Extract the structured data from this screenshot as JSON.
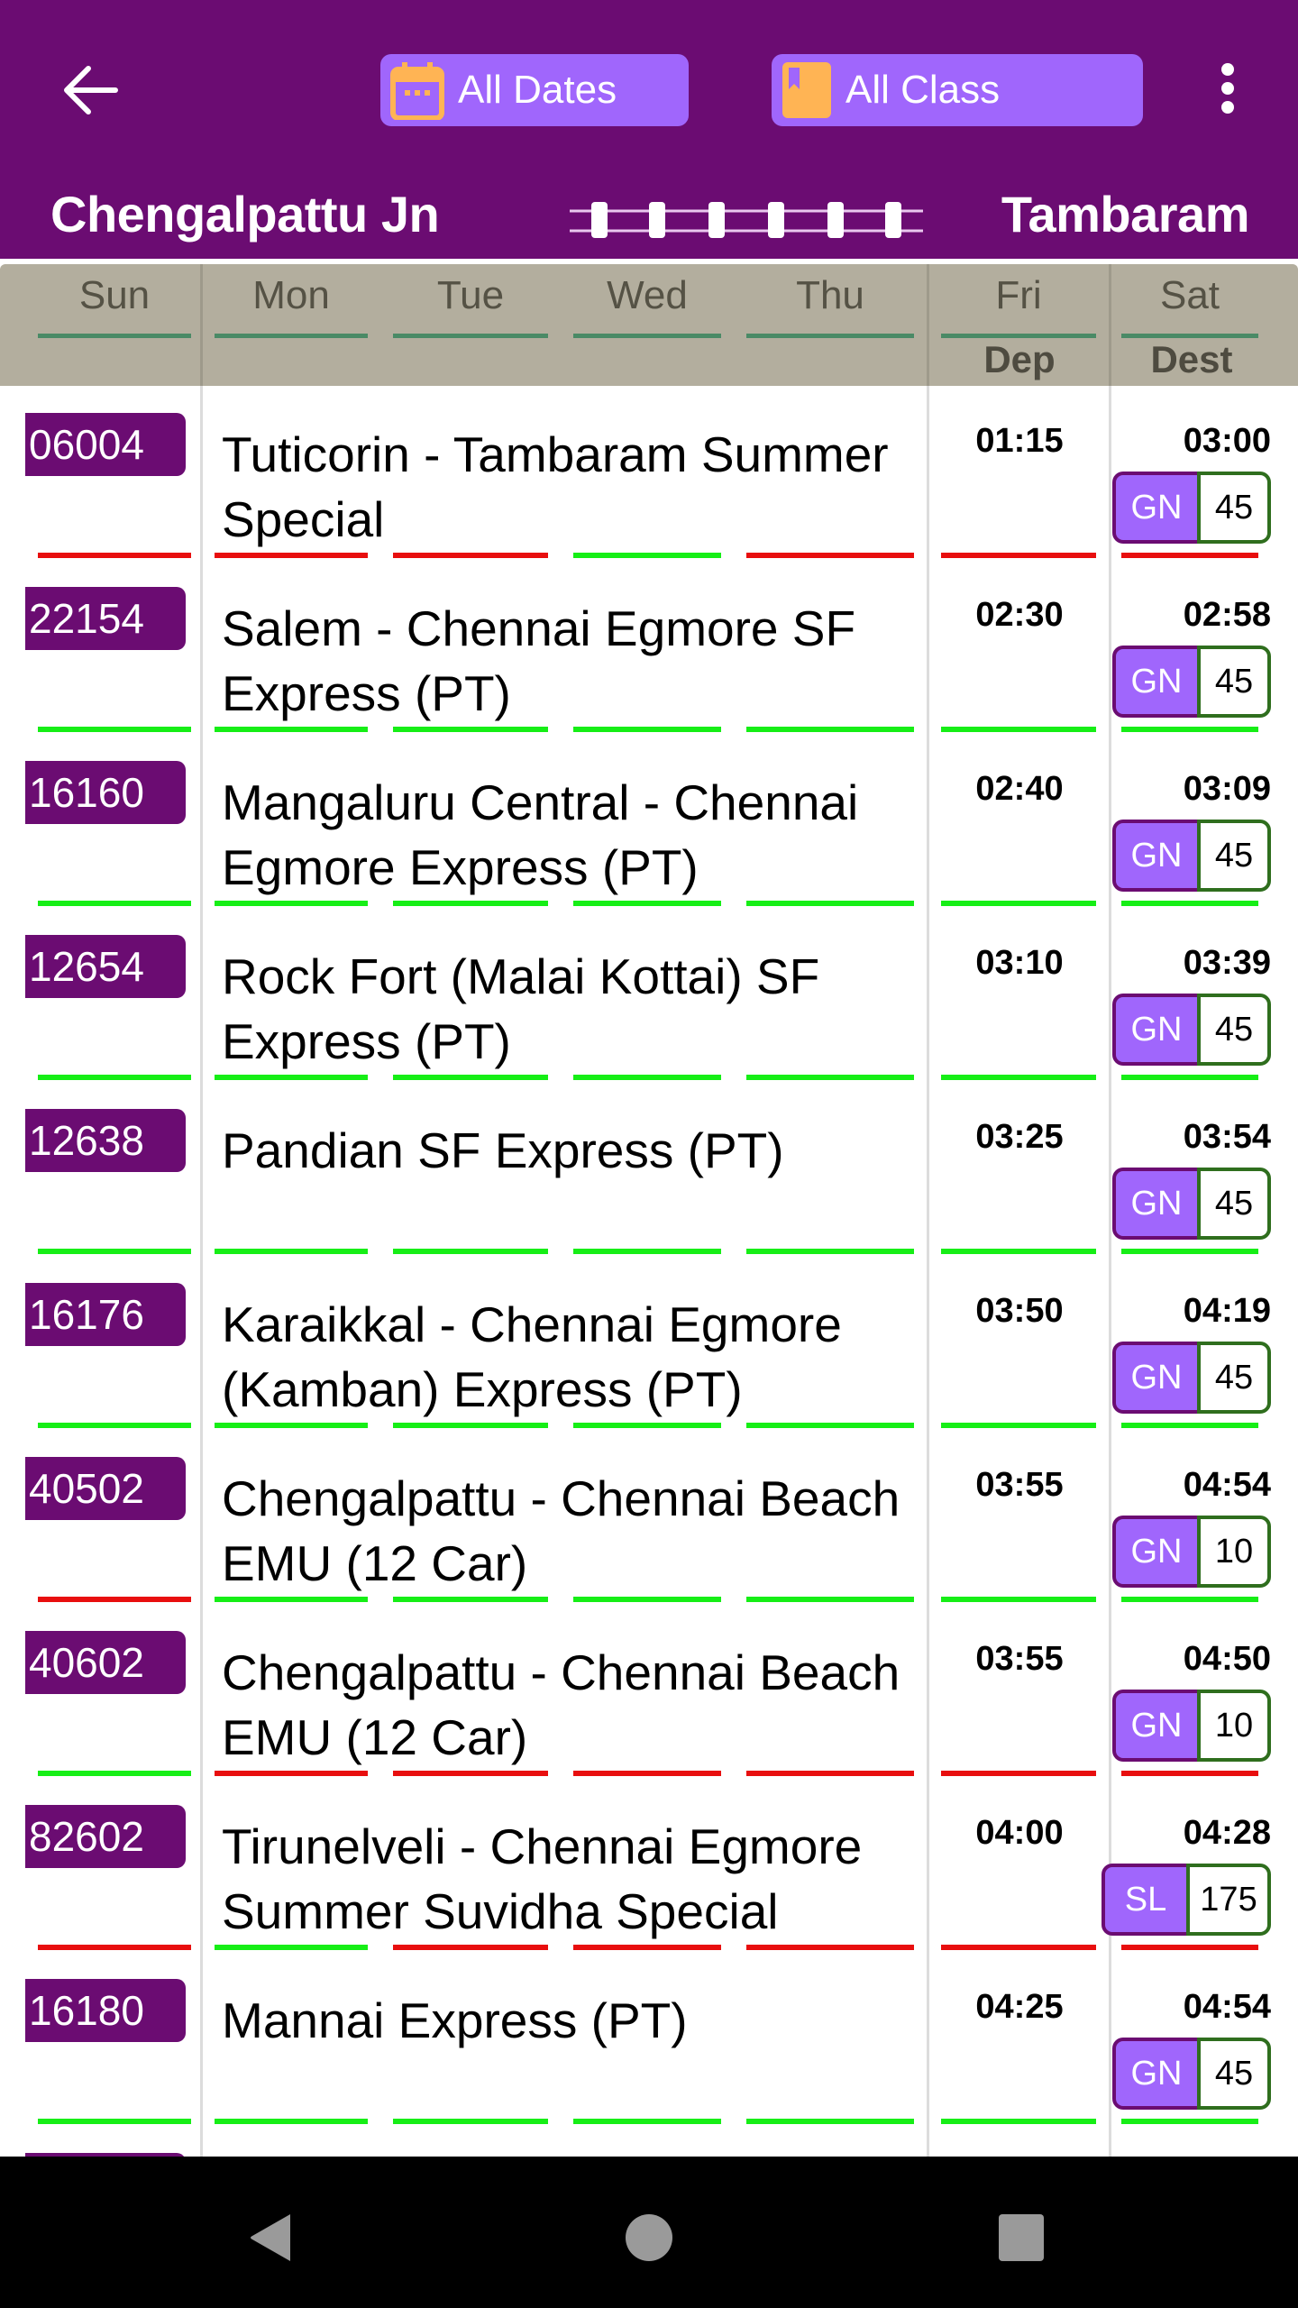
{
  "header": {
    "back_icon": "arrow-left-icon",
    "dates_button": {
      "label": "All Dates",
      "icon": "calendar-icon"
    },
    "class_button": {
      "label": "All Class",
      "icon": "bookmark-book-icon"
    },
    "menu_icon": "more-vertical-icon",
    "from_station": "Chengalpattu Jn",
    "to_station": "Tambaram",
    "route_icon": "rail-track-icon"
  },
  "colors": {
    "primary": "#6B0C72",
    "accent": "#A066FC",
    "icon_orange": "#FFB454",
    "header_gray": "#B3AE9E",
    "runs": "#16EE16",
    "not_runs": "#E80E0E"
  },
  "table_header": {
    "days": [
      "Sun",
      "Mon",
      "Tue",
      "Wed",
      "Thu",
      "Fri",
      "Sat"
    ],
    "dep_label": "Dep",
    "dest_label": "Dest"
  },
  "trains": [
    {
      "number": "06004",
      "name": "Tuticorin - Tambaram Summer Special",
      "dep": "01:15",
      "arr": "03:00",
      "class": "GN",
      "seats": "45",
      "days": [
        0,
        0,
        0,
        1,
        0,
        0,
        0
      ]
    },
    {
      "number": "22154",
      "name": "Salem - Chennai Egmore SF Express (PT)",
      "dep": "02:30",
      "arr": "02:58",
      "class": "GN",
      "seats": "45",
      "days": [
        1,
        1,
        1,
        1,
        1,
        1,
        1
      ]
    },
    {
      "number": "16160",
      "name": "Mangaluru Central - Chennai Egmore Express (PT)",
      "dep": "02:40",
      "arr": "03:09",
      "class": "GN",
      "seats": "45",
      "days": [
        1,
        1,
        1,
        1,
        1,
        1,
        1
      ]
    },
    {
      "number": "12654",
      "name": "Rock Fort (Malai Kottai) SF Express (PT)",
      "dep": "03:10",
      "arr": "03:39",
      "class": "GN",
      "seats": "45",
      "days": [
        1,
        1,
        1,
        1,
        1,
        1,
        1
      ]
    },
    {
      "number": "12638",
      "name": "Pandian SF Express (PT)",
      "dep": "03:25",
      "arr": "03:54",
      "class": "GN",
      "seats": "45",
      "days": [
        1,
        1,
        1,
        1,
        1,
        1,
        1
      ]
    },
    {
      "number": "16176",
      "name": "Karaikkal - Chennai Egmore (Kamban) Express (PT)",
      "dep": "03:50",
      "arr": "04:19",
      "class": "GN",
      "seats": "45",
      "days": [
        1,
        1,
        1,
        1,
        1,
        1,
        1
      ]
    },
    {
      "number": "40502",
      "name": "Chengalpattu - Chennai Beach EMU (12 Car)",
      "dep": "03:55",
      "arr": "04:54",
      "class": "GN",
      "seats": "10",
      "days": [
        0,
        1,
        1,
        1,
        1,
        1,
        1
      ]
    },
    {
      "number": "40602",
      "name": "Chengalpattu - Chennai Beach EMU (12 Car)",
      "dep": "03:55",
      "arr": "04:50",
      "class": "GN",
      "seats": "10",
      "days": [
        1,
        0,
        0,
        0,
        0,
        0,
        0
      ]
    },
    {
      "number": "82602",
      "name": "Tirunelveli - Chennai Egmore Summer Suvidha Special",
      "dep": "04:00",
      "arr": "04:28",
      "class": "SL",
      "seats": "175",
      "days": [
        0,
        1,
        0,
        0,
        0,
        0,
        0
      ]
    },
    {
      "number": "16180",
      "name": "Mannai Express (PT)",
      "dep": "04:25",
      "arr": "04:54",
      "class": "GN",
      "seats": "45",
      "days": [
        1,
        1,
        1,
        1,
        1,
        1,
        1
      ]
    },
    {
      "number": "",
      "name": "",
      "dep": "",
      "arr": "",
      "class": "",
      "seats": "",
      "days": []
    }
  ],
  "navbar": {
    "back": "nav-back-icon",
    "home": "nav-home-icon",
    "recents": "nav-recents-icon"
  }
}
